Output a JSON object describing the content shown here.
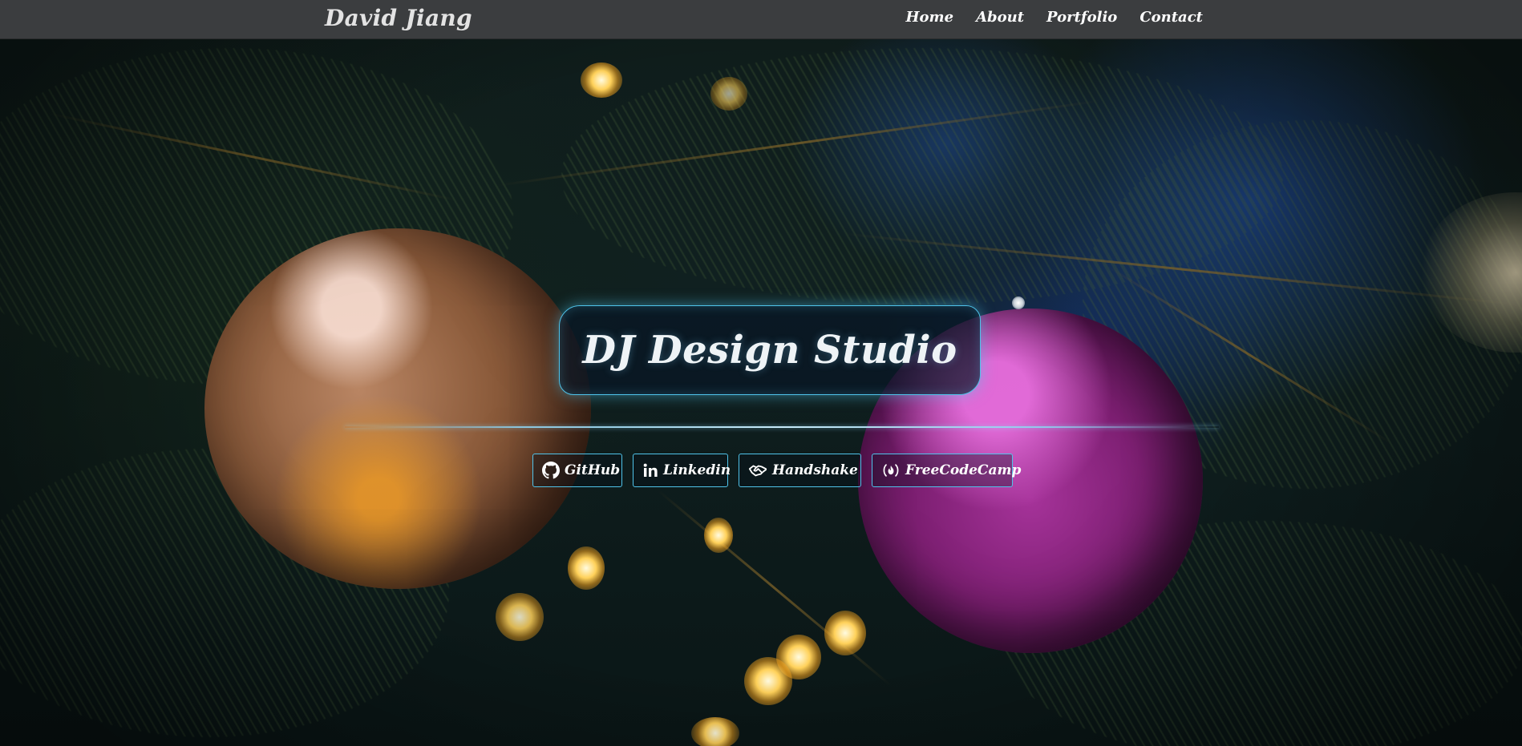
{
  "navbar": {
    "brand": "David Jiang",
    "links": [
      {
        "label": "Home"
      },
      {
        "label": "About"
      },
      {
        "label": "Portfolio"
      },
      {
        "label": "Contact"
      }
    ]
  },
  "hero": {
    "title": "DJ Design Studio"
  },
  "social": [
    {
      "label": "GitHub",
      "icon": "github-icon"
    },
    {
      "label": "Linkedin",
      "icon": "linkedin-icon"
    },
    {
      "label": "Handshake",
      "icon": "handshake-icon"
    },
    {
      "label": "FreeCodeCamp",
      "icon": "freecodecamp-icon"
    }
  ],
  "colors": {
    "navbar_bg": "#3b3d3f",
    "accent_border": "#4fc3ea",
    "text": "#ffffff"
  }
}
